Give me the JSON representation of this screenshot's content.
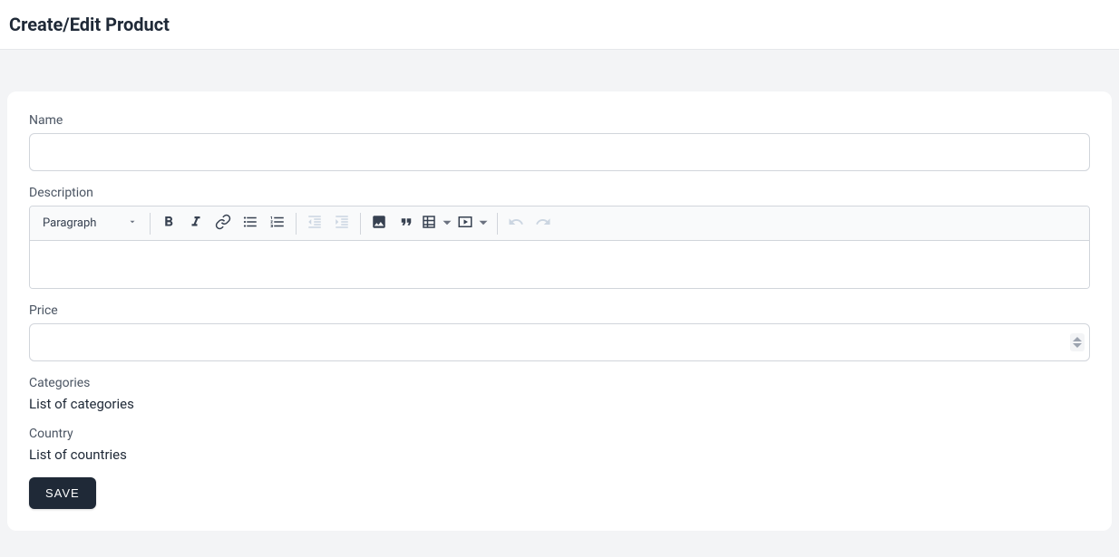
{
  "header": {
    "title": "Create/Edit Product"
  },
  "form": {
    "name": {
      "label": "Name",
      "value": ""
    },
    "description": {
      "label": "Description",
      "toolbar": {
        "format_selected": "Paragraph"
      },
      "value": ""
    },
    "price": {
      "label": "Price",
      "value": ""
    },
    "categories": {
      "label": "Categories",
      "value": "List of categories"
    },
    "country": {
      "label": "Country",
      "value": "List of countries"
    },
    "save_label": "SAVE"
  }
}
